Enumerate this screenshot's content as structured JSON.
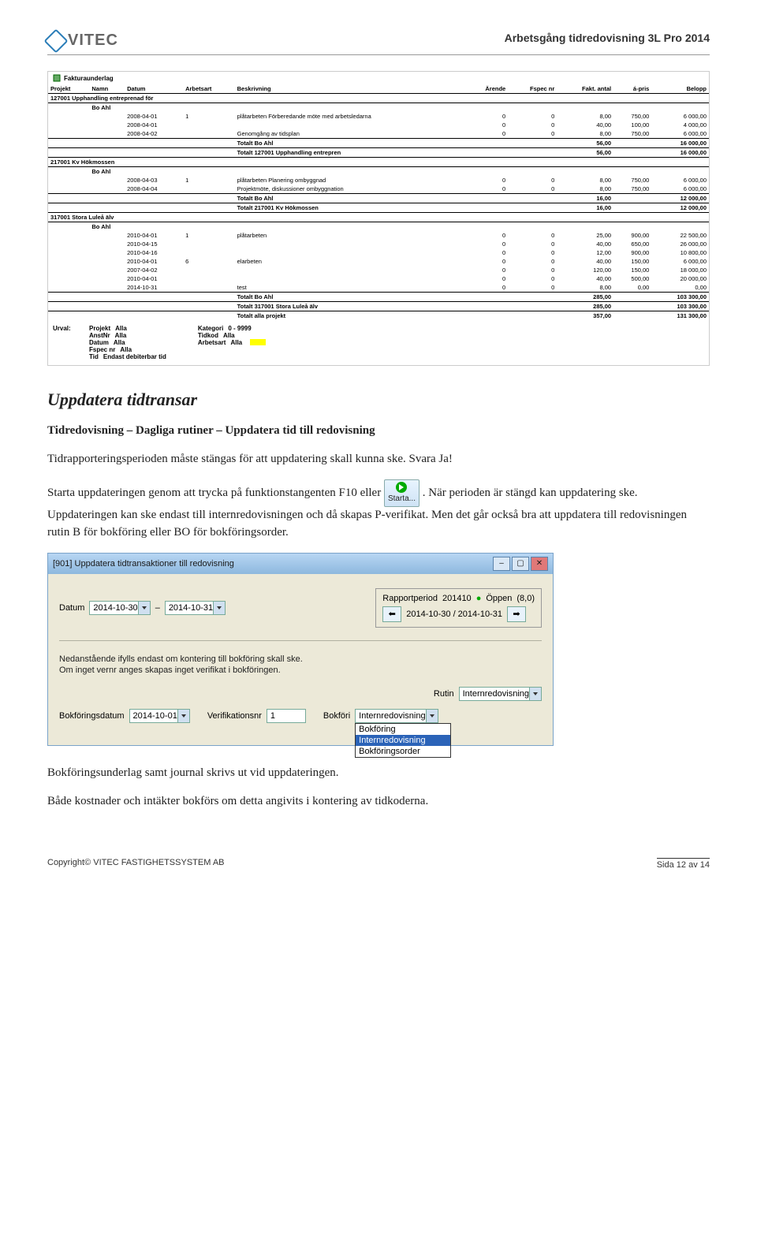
{
  "header": {
    "logo_text": "VITEC",
    "title": "Arbetsgång tidredovisning 3L Pro 2014"
  },
  "report": {
    "title": "Fakturaunderlag",
    "columns": [
      "Projekt",
      "Namn",
      "Datum",
      "Arbetsart",
      "Beskrivning",
      "Ärende",
      "Fspec nr",
      "Fakt. antal",
      "á-pris",
      "Belopp"
    ],
    "sections": [
      {
        "proj": "127001",
        "proj_name": "Upphandling entreprenad för",
        "person": "Bo Ahl",
        "rows": [
          {
            "datum": "2008-04-01",
            "art": "1",
            "arttext": "plåtarbeten",
            "beskr": "Förberedande möte med arbetsledarna",
            "arende": "0",
            "fspec": "0",
            "antal": "8,00",
            "pris": "750,00",
            "belopp": "6 000,00"
          },
          {
            "datum": "2008-04-01",
            "art": "",
            "arttext": "",
            "beskr": "",
            "arende": "0",
            "fspec": "0",
            "antal": "40,00",
            "pris": "100,00",
            "belopp": "4 000,00"
          },
          {
            "datum": "2008-04-02",
            "art": "",
            "arttext": "",
            "beskr": "Genomgång av tidsplan",
            "arende": "0",
            "fspec": "0",
            "antal": "8,00",
            "pris": "750,00",
            "belopp": "6 000,00"
          }
        ],
        "sub": {
          "label": "Totalt Bo Ahl",
          "antal": "56,00",
          "belopp": "16 000,00"
        },
        "tot": {
          "label": "Totalt  127001 Upphandling entrepren",
          "antal": "56,00",
          "belopp": "16 000,00"
        }
      },
      {
        "proj": "217001",
        "proj_name": "Kv Hökmossen",
        "person": "Bo Ahl",
        "rows": [
          {
            "datum": "2008-04-03",
            "art": "1",
            "arttext": "plåtarbeten",
            "beskr": "Planering ombyggnad",
            "arende": "0",
            "fspec": "0",
            "antal": "8,00",
            "pris": "750,00",
            "belopp": "6 000,00"
          },
          {
            "datum": "2008-04-04",
            "art": "",
            "arttext": "",
            "beskr": "Projektmöte, diskussioner ombyggnation",
            "arende": "0",
            "fspec": "0",
            "antal": "8,00",
            "pris": "750,00",
            "belopp": "6 000,00"
          }
        ],
        "sub": {
          "label": "Totalt Bo Ahl",
          "antal": "16,00",
          "belopp": "12 000,00"
        },
        "tot": {
          "label": "Totalt  217001 Kv Hökmossen",
          "antal": "16,00",
          "belopp": "12 000,00"
        }
      },
      {
        "proj": "317001",
        "proj_name": "Stora Luleå älv",
        "person": "Bo Ahl",
        "rows": [
          {
            "datum": "2010-04-01",
            "art": "1",
            "arttext": "plåtarbeten",
            "beskr": "",
            "arende": "0",
            "fspec": "0",
            "antal": "25,00",
            "pris": "900,00",
            "belopp": "22 500,00"
          },
          {
            "datum": "2010-04-15",
            "art": "",
            "arttext": "",
            "beskr": "",
            "arende": "0",
            "fspec": "0",
            "antal": "40,00",
            "pris": "650,00",
            "belopp": "26 000,00"
          },
          {
            "datum": "2010-04-16",
            "art": "",
            "arttext": "",
            "beskr": "",
            "arende": "0",
            "fspec": "0",
            "antal": "12,00",
            "pris": "900,00",
            "belopp": "10 800,00"
          },
          {
            "datum": "2010-04-01",
            "art": "6",
            "arttext": "elarbeten",
            "beskr": "",
            "arende": "0",
            "fspec": "0",
            "antal": "40,00",
            "pris": "150,00",
            "belopp": "6 000,00"
          },
          {
            "datum": "2007-04-02",
            "art": "",
            "arttext": "",
            "beskr": "",
            "arende": "0",
            "fspec": "0",
            "antal": "120,00",
            "pris": "150,00",
            "belopp": "18 000,00"
          },
          {
            "datum": "2010-04-01",
            "art": "",
            "arttext": "",
            "beskr": "",
            "arende": "0",
            "fspec": "0",
            "antal": "40,00",
            "pris": "500,00",
            "belopp": "20 000,00"
          },
          {
            "datum": "2014-10-31",
            "art": "",
            "arttext": "",
            "beskr": "test",
            "arende": "0",
            "fspec": "0",
            "antal": "8,00",
            "pris": "0,00",
            "belopp": "0,00"
          }
        ],
        "sub": {
          "label": "Totalt Bo Ahl",
          "antal": "285,00",
          "belopp": "103 300,00"
        },
        "tot": {
          "label": "Totalt  317001 Stora Luleå älv",
          "antal": "285,00",
          "belopp": "103 300,00"
        }
      }
    ],
    "grand": {
      "label": "Totalt alla projekt",
      "antal": "357,00",
      "belopp": "131 300,00"
    },
    "footer": {
      "left": [
        {
          "lbl": "Urval:",
          "k": "Projekt",
          "v": "Alla"
        },
        {
          "lbl": "",
          "k": "AnstNr",
          "v": "Alla"
        },
        {
          "lbl": "",
          "k": "Datum",
          "v": "Alla"
        },
        {
          "lbl": "",
          "k": "Fspec nr",
          "v": "Alla"
        },
        {
          "lbl": "",
          "k": "Tid",
          "v": "Endast debiterbar tid"
        }
      ],
      "right": [
        {
          "k": "Kategori",
          "v": "0 - 9999"
        },
        {
          "k": "Tidkod",
          "v": "Alla"
        },
        {
          "k": "Arbetsart",
          "v": "Alla"
        }
      ]
    }
  },
  "section1_title": "Uppdatera tidtransar",
  "para1": "Tidredovisning – Dagliga rutiner – Uppdatera tid till redovisning",
  "para2": "Tidrapporteringsperioden måste stängas för att uppdatering skall kunna ske. Svara Ja!",
  "para3a": "Starta uppdateringen genom att trycka på funktionstangenten F10 eller ",
  "starta_label": "Starta...",
  "para3b": ". När perioden är stängd kan uppdatering ske. Uppdateringen kan ske endast till internredovisningen och då skapas P-verifikat. Men det går också bra att uppdatera till redovisningen rutin B för bokföring eller BO för bokföringsorder.",
  "win": {
    "title": "[901]  Uppdatera tidtransaktioner till redovisning",
    "rapport_label": "Rapportperiod",
    "rapport_val": "201410",
    "status": "Öppen",
    "status2": "(8,0)",
    "datum_label": "Datum",
    "date_from": "2014-10-30",
    "date_to": "2014-10-31",
    "range": "2014-10-30 / 2014-10-31",
    "note1": "Nedanstående ifylls endast om kontering till bokföring skall ske.",
    "note2": "Om inget vernr anges skapas inget verifikat i bokföringen.",
    "bokdatum_label": "Bokföringsdatum",
    "bokdatum": "2014-10-01",
    "ver_label": "Verifikationsnr",
    "ver": "1",
    "bokforing_label": "Bokföri",
    "rutin_label": "Rutin",
    "rutin_val": "Internredovisning",
    "options": [
      "Bokföring",
      "Internredovisning",
      "Bokföringsorder"
    ]
  },
  "para4": "Bokföringsunderlag samt journal skrivs ut vid uppdateringen.",
  "para5": "Både kostnader och intäkter bokförs om detta angivits i kontering av tidkoderna.",
  "footer": {
    "left": "Copyright© VITEC FASTIGHETSSYSTEM AB",
    "right": "Sida 12 av 14"
  }
}
